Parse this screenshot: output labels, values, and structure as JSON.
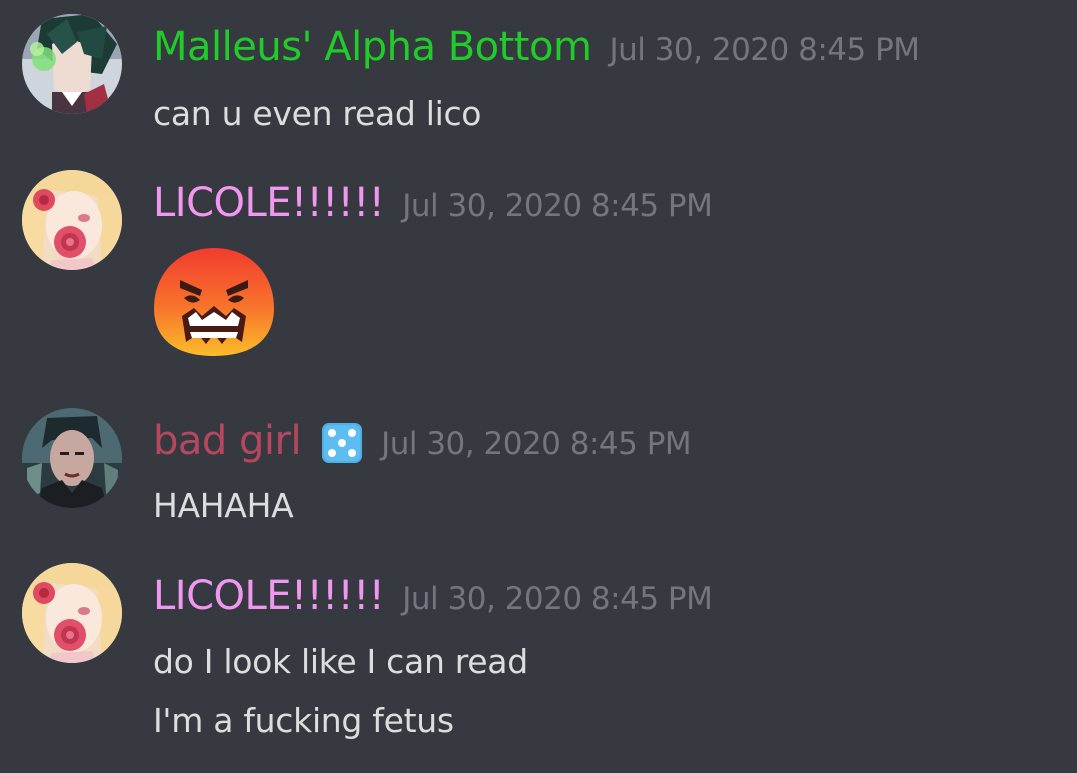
{
  "messages": [
    {
      "username": "Malleus' Alpha Bottom",
      "username_color": "#1fcc2a",
      "timestamp": "Jul 30, 2020 8:45 PM",
      "avatar_icon": "anime-character-avatar",
      "lines": [
        "can u even read lico"
      ]
    },
    {
      "username": "LICOLE!!!!!!",
      "username_color": "#f097f0",
      "timestamp": "Jul 30, 2020 8:45 PM",
      "avatar_icon": "anime-blonde-rose-avatar",
      "emoji": "angry-blob-emoji"
    },
    {
      "username": "bad girl",
      "username_color": "#b5475e",
      "timestamp": "Jul 30, 2020 8:45 PM",
      "avatar_icon": "dark-character-avatar",
      "badge_icon": "game-die-icon",
      "lines": [
        "HAHAHA"
      ]
    },
    {
      "username": "LICOLE!!!!!!",
      "username_color": "#f097f0",
      "timestamp": "Jul 30, 2020 8:45 PM",
      "avatar_icon": "anime-blonde-rose-avatar",
      "lines": [
        "do I look like I can read",
        "I'm a fucking fetus"
      ]
    }
  ]
}
